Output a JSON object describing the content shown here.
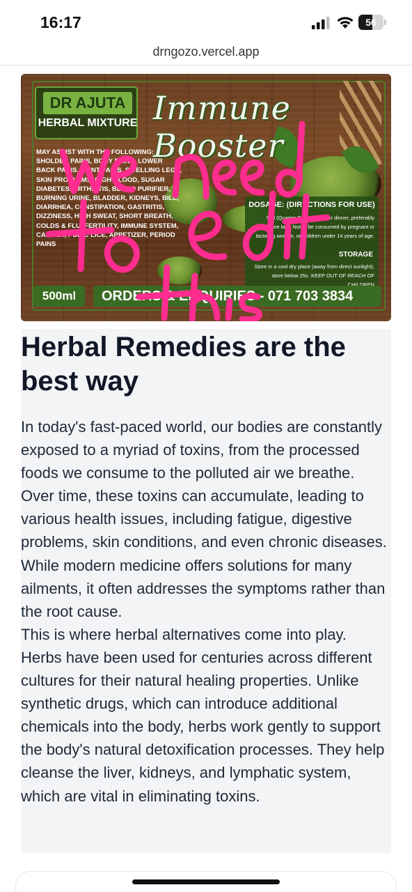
{
  "status_bar": {
    "time": "16:17",
    "battery_level": "56",
    "icons": [
      "signal-icon",
      "wifi-icon",
      "battery-icon"
    ]
  },
  "browser": {
    "url": "drngozo.vercel.app"
  },
  "hero_image": {
    "brand": "DR AJUTA",
    "brand_sub": "HERBAL MIXTURE",
    "product_title": "Immune Booster",
    "indications": "MAY ASSIST WITH THE FOLLOWING: SHOLDER PAINS, BODY PAINS, LOWER BACK PAINS, JOINT PAINS, SWELLING LEGS, SKIN PROBLEMS, HIGH BLOOD, SUGAR DIABETES, ARTHRITIS, BLOOD PURIFIER, BURNING URINE, BLADDER, KIDNEYS, BILE, DIARRHEA, CONSTIPATION, GASTRITIS, DIZZINESS, HIGH SWEAT, SHORT BREATH, COLDS & FLU, FERTILITY, IMMUNE SYSTEM, CANCER, PUBIC LICE, APPETIZER, PERIOD PAINS",
    "dosage_title": "DOSAGE: (DIRECTIONS FOR USE)",
    "dosage_text": "5ml (Quarter Cup) daily after dinner, preferably before bed. Not to be consumed by pregnant or lactating woman, or children under 14 years of age.",
    "storage_title": "STORAGE",
    "storage_text": "Store in a cool dry place (away from direct sunlight), store below 25c. KEEP OUT OF REACH OF CHILDREN",
    "volume": "500ml",
    "order_text": "ORDERS & ENQUIRIES - 071 703 3834",
    "handwritten_annotation": "we need to edit this",
    "annotation_color": "#ff2d8f",
    "accent_green": "#3a6b22"
  },
  "article": {
    "title": "Herbal Remedies are the best way",
    "paragraphs": [
      "In today's fast-paced world, our bodies are constantly exposed to a myriad of toxins, from the processed foods we consume to the polluted air we breathe. Over time, these toxins can accumulate, leading to various health issues, including fatigue, digestive problems, skin conditions, and even chronic diseases. While modern medicine offers solutions for many ailments, it often addresses the symptoms rather than the root cause.",
      "This is where herbal alternatives come into play. Herbs have been used for centuries across different cultures for their natural healing properties. Unlike synthetic drugs, which can introduce additional chemicals into the body, herbs work gently to support the body's natural detoxification processes. They help cleanse the liver, kidneys, and lymphatic system, which are vital in eliminating toxins."
    ]
  }
}
